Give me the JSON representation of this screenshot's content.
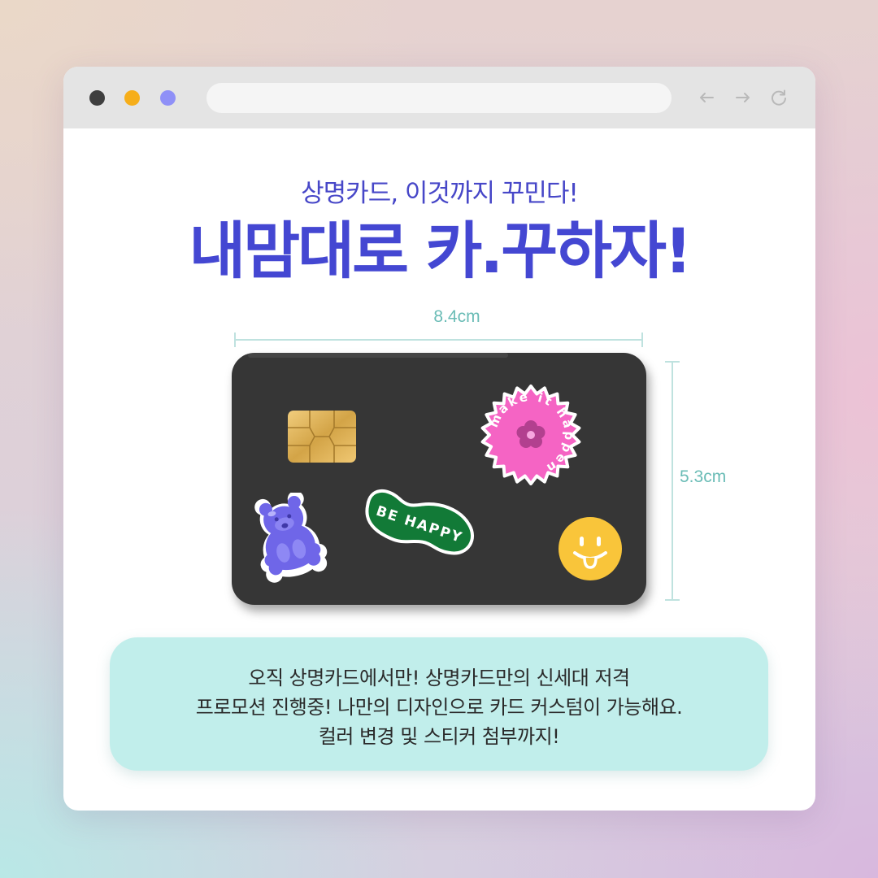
{
  "browser": {
    "controls": [
      "close-dot",
      "minimize-dot",
      "maximize-dot"
    ],
    "nav_icons": [
      "back-arrow-icon",
      "forward-arrow-icon",
      "reload-icon"
    ],
    "colors": {
      "close": "#3e3e3e",
      "minimize": "#f6ae1a",
      "maximize": "#8f90f7"
    }
  },
  "content": {
    "subtitle": "상명카드, 이것까지 꾸민다!",
    "headline": "내맘대로 카.꾸하자!"
  },
  "card": {
    "width_label": "8.4cm",
    "height_label": "5.3cm",
    "stickers": {
      "flower_badge_text": "make it happen",
      "wavy_badge_text": "BE HAPPY"
    },
    "colors": {
      "card": "#363636",
      "badge_pink": "#f564c4",
      "badge_green": "#127a37",
      "smiley": "#f9c53a",
      "bear": "#6f66e8"
    }
  },
  "callout": {
    "line1": "오직 상명카드에서만! 상명카드만의 신세대 저격",
    "line2": "프로모션 진행중! 나만의 디자인으로 카드 커스텀이 가능해요.",
    "line3": "컬러 변경 및 스티커 첨부까지!"
  },
  "theme": {
    "accent": "#4447d2",
    "callout_bg": "#c1eeeb",
    "dimension": "#6abcb6"
  }
}
